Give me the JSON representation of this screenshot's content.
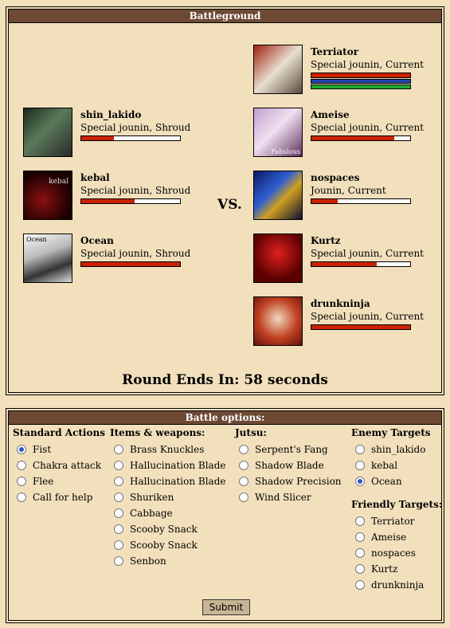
{
  "battle": {
    "title": "Battleground",
    "vs": "VS.",
    "round_text": "Round Ends In: 58 seconds"
  },
  "allies": [
    {
      "name": "shin_lakido",
      "rank": "Special jounin, Shroud",
      "hp": 0.33,
      "avatar_icon": "ninja-avatar-icon",
      "avatar_color": "#3a4a3a"
    },
    {
      "name": "kebal",
      "rank": "Special jounin, Shroud",
      "hp": 0.54,
      "avatar_icon": "dark-avatar-icon",
      "avatar_text": "kebal",
      "avatar_color": "#3a0a0a"
    },
    {
      "name": "Ocean",
      "rank": "Special jounin, Shroud",
      "hp": 1.0,
      "avatar_icon": "ocean-avatar-icon",
      "avatar_text": "Ocean",
      "avatar_color": "#d8d8d8"
    }
  ],
  "enemies": [
    {
      "name": "Terriator",
      "rank": "Special jounin, Current",
      "hp": 1.0,
      "chakra": 1.0,
      "stamina": 1.0,
      "avatar_icon": "red-hair-avatar-icon",
      "avatar_color": "#7a5a50"
    },
    {
      "name": "Ameise",
      "rank": "Special jounin, Current",
      "hp": 0.84,
      "avatar_icon": "anime-avatar-icon",
      "avatar_text": "Fabulous",
      "avatar_color": "#6a3a6a"
    },
    {
      "name": "nospaces",
      "rank": "Jounin, Current",
      "hp": 0.27,
      "avatar_icon": "blue-hero-avatar-icon",
      "avatar_color": "#1a2a8a"
    },
    {
      "name": "Kurtz",
      "rank": "Special jounin, Current",
      "hp": 0.66,
      "avatar_icon": "red-ninja-avatar-icon",
      "avatar_color": "#8a1010"
    },
    {
      "name": "drunkninja",
      "rank": "Special jounin, Current",
      "hp": 1.0,
      "avatar_icon": "gaara-avatar-icon",
      "avatar_color": "#b04020"
    }
  ],
  "options": {
    "title": "Battle options:",
    "standard": {
      "heading": "Standard Actions",
      "items": [
        "Fist",
        "Chakra attack",
        "Flee",
        "Call for help"
      ],
      "selected": 0
    },
    "items": {
      "heading": "Items & weapons:",
      "items": [
        "Brass Knuckles",
        "Hallucination Blade",
        "Hallucination Blade",
        "Shuriken",
        "Cabbage",
        "Scooby Snack",
        "Scooby Snack",
        "Senbon"
      ]
    },
    "jutsu": {
      "heading": "Jutsu:",
      "items": [
        "Serpent's Fang",
        "Shadow Blade",
        "Shadow Precision",
        "Wind Slicer"
      ]
    },
    "enemy_targets": {
      "heading": "Enemy Targets",
      "items": [
        "shin_lakido",
        "kebal",
        "Ocean"
      ],
      "selected": 2
    },
    "friendly_targets": {
      "heading": "Friendly Targets:",
      "items": [
        "Terriator",
        "Ameise",
        "nospaces",
        "Kurtz",
        "drunkninja"
      ]
    },
    "submit_label": "Submit"
  },
  "colors": {
    "hp": "#cc2200",
    "chakra": "#2244aa",
    "stamina": "#22aa33",
    "header": "#6e4a35",
    "bg": "#f2e0bc"
  }
}
